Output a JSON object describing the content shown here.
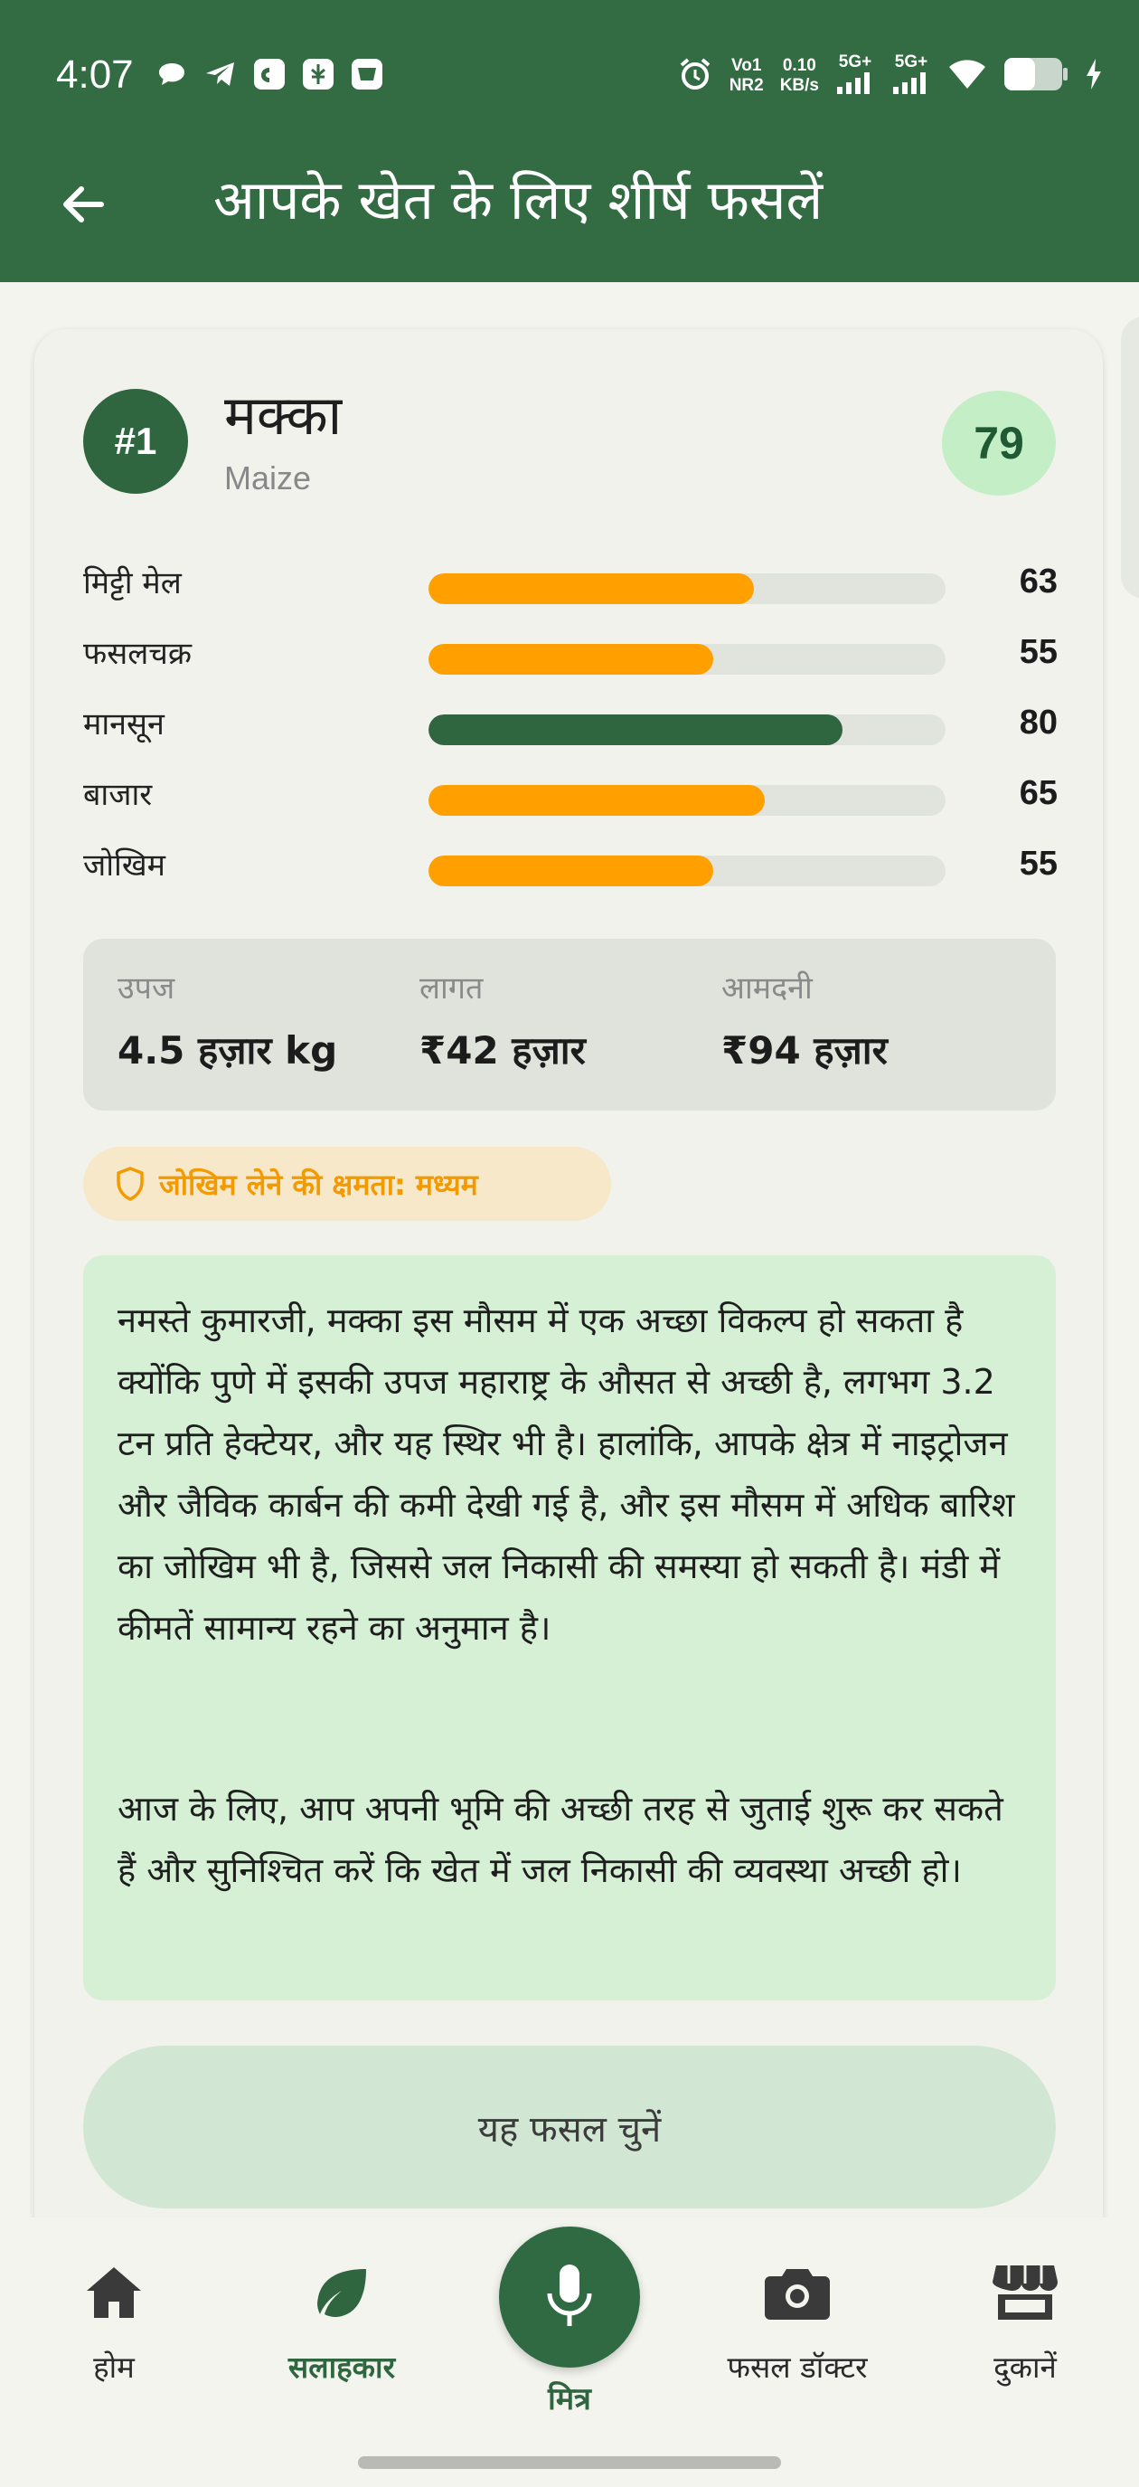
{
  "status_bar": {
    "time": "4:07",
    "net_top": "Vo1",
    "net_bottom": "NR2",
    "speed_top": "0.10",
    "speed_bottom": "KB/s",
    "sig1": "5G+",
    "sig2": "5G+",
    "icons_left": [
      "chat-bubble-icon",
      "telegram-icon",
      "app-icon",
      "app-icon",
      "app-icon"
    ],
    "icons_right": [
      "alarm-icon",
      "signal-icon",
      "signal-icon",
      "wifi-icon",
      "battery-icon",
      "charging-icon"
    ]
  },
  "header": {
    "title": "आपके खेत के लिए शीर्ष फसलें"
  },
  "crop": {
    "rank": "#1",
    "name": "मक्का",
    "english": "Maize",
    "score": "79",
    "metrics": [
      {
        "label": "मिट्टी मेल",
        "value": 63,
        "display": "63",
        "color": "#ffa000"
      },
      {
        "label": "फसलचक्र",
        "value": 55,
        "display": "55",
        "color": "#ffa000"
      },
      {
        "label": "मानसून",
        "value": 80,
        "display": "80",
        "color": "#2f6640"
      },
      {
        "label": "बाजार",
        "value": 65,
        "display": "65",
        "color": "#ffa000"
      },
      {
        "label": "जोखिम",
        "value": 55,
        "display": "55",
        "color": "#ffa000"
      }
    ],
    "stats": [
      {
        "label": "उपज",
        "value": "4.5 हज़ार kg"
      },
      {
        "label": "लागत",
        "value": "₹42 हज़ार"
      },
      {
        "label": "आमदनी",
        "value": "₹94 हज़ार"
      }
    ],
    "risk_label": "जोखिम लेने की क्षमता: मध्यम",
    "advice_p1": "नमस्ते कुमारजी, मक्का इस मौसम में एक अच्छा विकल्प हो सकता है क्योंकि पुणे में इसकी उपज महाराष्ट्र के औसत से अच्छी है, लगभग 3.2 टन प्रति हेक्टेयर, और यह स्थिर भी है। हालांकि, आपके क्षेत्र में नाइट्रोजन और जैविक कार्बन की कमी देखी गई है, और इस मौसम में अधिक बारिश का जोखिम भी है, जिससे जल निकासी की समस्या हो सकती है। मंडी में कीमतें सामान्य रहने का अनुमान है।",
    "advice_p2": "आज के लिए, आप अपनी भूमि की अच्छी तरह से जुताई शुरू कर सकते हैं और सुनिश्चित करें कि खेत में जल निकासी की व्यवस्था अच्छी हो।",
    "choose_button": "यह फसल चुनें"
  },
  "nav": {
    "items": [
      {
        "label": "होम",
        "icon": "home-icon"
      },
      {
        "label": "सलाहकार",
        "icon": "leaf-icon",
        "active": true
      },
      {
        "label": "मित्र",
        "icon": "mic-icon"
      },
      {
        "label": "फसल डॉक्टर",
        "icon": "camera-icon"
      },
      {
        "label": "दुकानें",
        "icon": "store-icon"
      }
    ]
  },
  "colors": {
    "primary": "#336b43",
    "accent_orange": "#ffa000",
    "score_bg": "#c4eec6",
    "advice_bg": "#d6f0d6"
  }
}
